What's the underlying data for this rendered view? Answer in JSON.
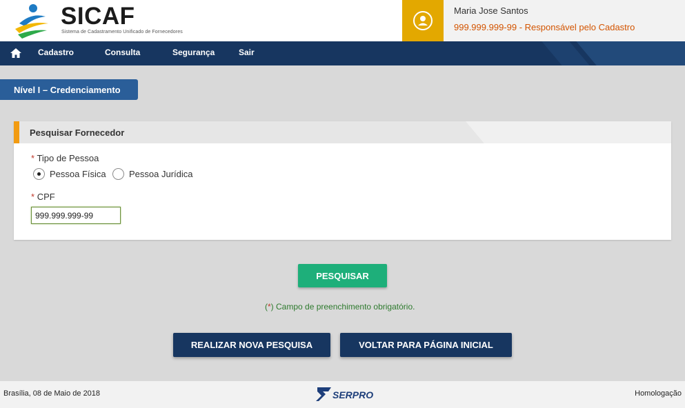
{
  "header": {
    "logo_title": "SICAF",
    "logo_subtitle": "Sistema de Cadastramento Unificado de Fornecedores",
    "user_name": "Maria Jose Santos",
    "user_role": "999.999.999-99 - Responsável pelo Cadastro"
  },
  "nav": {
    "items": [
      {
        "label": "Cadastro"
      },
      {
        "label": "Consulta"
      },
      {
        "label": "Segurança"
      },
      {
        "label": "Sair"
      }
    ]
  },
  "level_tab": "Nível I – Credenciamento",
  "panel": {
    "title": "Pesquisar Fornecedor",
    "required_marker": "*",
    "tipo_label": "Tipo de Pessoa",
    "radio_options": [
      {
        "label": "Pessoa Física",
        "checked": true
      },
      {
        "label": "Pessoa Jurídica",
        "checked": false
      }
    ],
    "cpf_label": "CPF",
    "cpf_value": "999.999.999-99"
  },
  "actions": {
    "search_label": "PESQUISAR",
    "required_note_prefix": "(",
    "required_note_marker": "*",
    "required_note_suffix": ") Campo de preenchimento obrigatório.",
    "new_search_label": "REALIZAR NOVA PESQUISA",
    "home_label": "VOLTAR PARA PÁGINA INICIAL"
  },
  "footer": {
    "date": "Brasília, 08 de Maio de 2018",
    "brand": "SERPRO",
    "environment": "Homologação"
  },
  "colors": {
    "nav": "#173660",
    "accent_yellow": "#e3a800",
    "search_button": "#1eaf7a",
    "required": "#c0392b",
    "role_text": "#d35400"
  }
}
